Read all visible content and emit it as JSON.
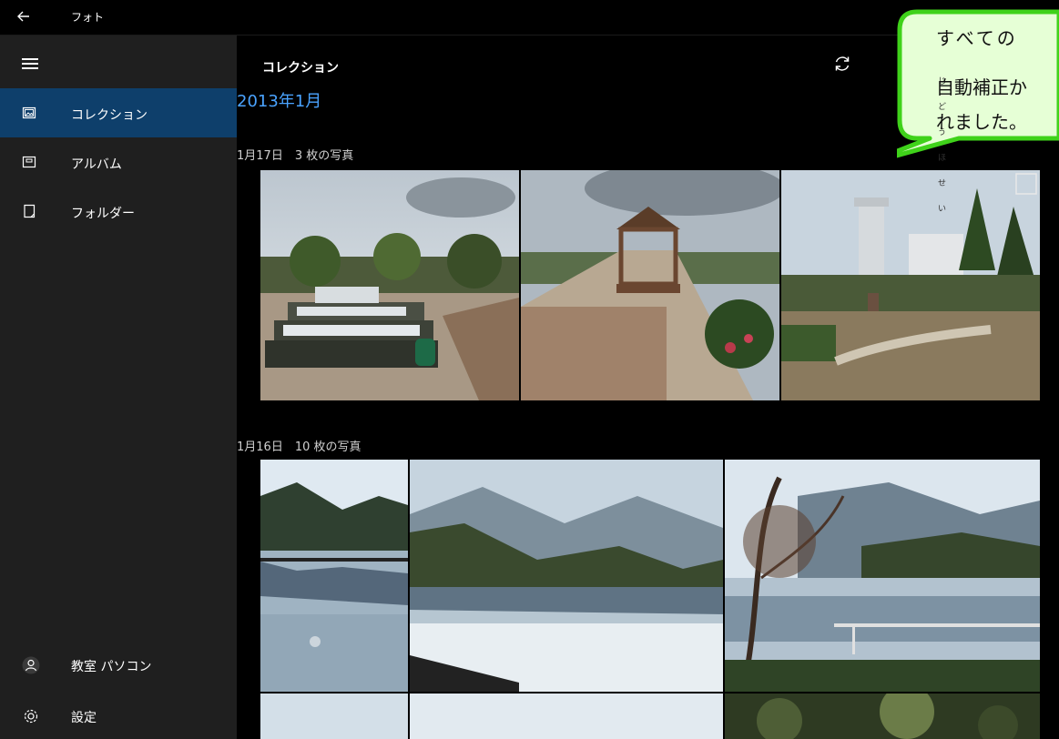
{
  "window": {
    "title": "フォト"
  },
  "sidebar": {
    "items": [
      {
        "label": "コレクション",
        "icon": "collection-icon",
        "active": true
      },
      {
        "label": "アルバム",
        "icon": "album-icon",
        "active": false
      },
      {
        "label": "フォルダー",
        "icon": "folder-icon",
        "active": false
      }
    ],
    "user": {
      "label": "教室 パソコン",
      "icon": "person-icon"
    },
    "settings": {
      "label": "設定",
      "icon": "gear-icon"
    }
  },
  "main": {
    "header_title": "コレクション",
    "month": "2013年1月",
    "groups": [
      {
        "label": "1月17日　3 枚の写真"
      },
      {
        "label": "1月16日　10 枚の写真"
      }
    ]
  },
  "callout": {
    "line1": "すべての",
    "ruby": "じどうほせい",
    "line2": "自動補正か",
    "line3": "れました。"
  },
  "colors": {
    "accent": "#4aa3ff",
    "active_nav": "#0e3f6b",
    "callout_fill": "#e6ffd6",
    "callout_border": "#3fd21a"
  }
}
